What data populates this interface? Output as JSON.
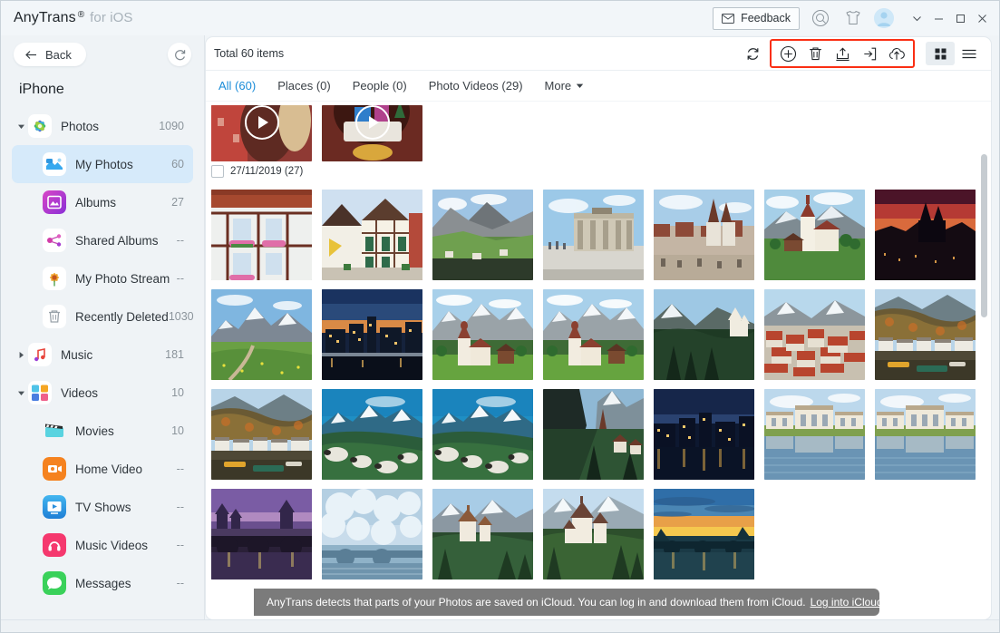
{
  "window": {
    "brand_name": "AnyTrans",
    "brand_reg": "®",
    "brand_sub": "for iOS",
    "feedback_label": "Feedback",
    "icons": {
      "mail": "mail-icon",
      "search": "search-icon",
      "tshirt": "tshirt-icon",
      "avatar": "avatar-icon",
      "chevron_down": "chevron-down-icon",
      "minimize": "minimize-icon",
      "maximize": "maximize-icon",
      "close": "close-icon"
    }
  },
  "sidebar": {
    "back_label": "Back",
    "refresh_icon": "refresh-icon",
    "device_name": "iPhone",
    "items": [
      {
        "label": "Photos",
        "count": "1090",
        "expanded": true,
        "level": 0,
        "icon": "photos-icon",
        "selected": false
      },
      {
        "label": "My Photos",
        "count": "60",
        "expanded": null,
        "level": 1,
        "icon": "my-photos-icon",
        "selected": true
      },
      {
        "label": "Albums",
        "count": "27",
        "expanded": null,
        "level": 1,
        "icon": "albums-icon",
        "selected": false
      },
      {
        "label": "Shared Albums",
        "count": "--",
        "expanded": null,
        "level": 1,
        "icon": "shared-albums-icon",
        "selected": false
      },
      {
        "label": "My Photo Stream",
        "count": "--",
        "expanded": null,
        "level": 1,
        "icon": "photo-stream-icon",
        "selected": false
      },
      {
        "label": "Recently Deleted",
        "count": "1030",
        "expanded": null,
        "level": 1,
        "icon": "recently-deleted-icon",
        "selected": false
      },
      {
        "label": "Music",
        "count": "181",
        "expanded": false,
        "level": 0,
        "icon": "music-icon",
        "selected": false
      },
      {
        "label": "Videos",
        "count": "10",
        "expanded": true,
        "level": 0,
        "icon": "videos-icon",
        "selected": false
      },
      {
        "label": "Movies",
        "count": "10",
        "expanded": null,
        "level": 1,
        "icon": "movies-icon",
        "selected": false
      },
      {
        "label": "Home Video",
        "count": "--",
        "expanded": null,
        "level": 1,
        "icon": "home-video-icon",
        "selected": false
      },
      {
        "label": "TV Shows",
        "count": "--",
        "expanded": null,
        "level": 1,
        "icon": "tv-shows-icon",
        "selected": false
      },
      {
        "label": "Music Videos",
        "count": "--",
        "expanded": null,
        "level": 1,
        "icon": "music-videos-icon",
        "selected": false
      },
      {
        "label": "Messages",
        "count": "--",
        "expanded": null,
        "level": 1,
        "icon": "messages-icon",
        "selected": false
      }
    ]
  },
  "main": {
    "total_label": "Total 60 items",
    "toolbar": {
      "refresh": "refresh-icon",
      "add": "add-circle-icon",
      "delete": "trash-icon",
      "export_to_computer": "export-to-computer-icon",
      "send_to_device": "send-to-device-icon",
      "to_icloud": "cloud-upload-icon",
      "grid_view": "grid-view-icon",
      "list_view": "list-view-icon",
      "highlight_color": "#fa2f14"
    },
    "tabs": [
      {
        "label": "All (60)",
        "active": true
      },
      {
        "label": "Places (0)",
        "active": false
      },
      {
        "label": "People (0)",
        "active": false
      },
      {
        "label": "Photo Videos (29)",
        "active": false
      },
      {
        "label": "More",
        "active": false
      }
    ],
    "group": {
      "date_label": "27/11/2019 (27)",
      "checked": false
    },
    "banner": {
      "text": "AnyTrans detects that parts of your Photos are saved on iCloud. You can log in and download them from iCloud.",
      "link": "Log into iCloud >"
    },
    "accent_color": "#1a8cd8"
  },
  "gallery": {
    "videos": [
      {
        "name": "video-portrait-thumbnail",
        "has_play": true
      },
      {
        "name": "video-ornament-thumbnail",
        "has_play": true
      }
    ],
    "photos": [
      "half-timbered-house-flowers",
      "half-timbered-town-square",
      "alpine-valley-cliff",
      "brandenburg-gate",
      "prague-old-town-square",
      "church-alpine-meadow",
      "prague-castle-sunset",
      "alpine-meadow-peak",
      "city-dusk-skyline",
      "church-zugspitze-a",
      "church-zugspitze-b",
      "neuschwanstein-forest",
      "red-roof-town-hill",
      "lake-village-boats-a",
      "lake-village-boats-b",
      "sheep-mountain-valley-a",
      "sheep-mountain-valley-b",
      "alpine-gorge-village",
      "berlin-night-river",
      "palace-reflection-a",
      "palace-reflection-b",
      "bridge-river-castle",
      "winter-frost-bridge",
      "castle-mountain-lake",
      "neuschwanstein-autumn",
      "sunset-bridge-river"
    ]
  }
}
